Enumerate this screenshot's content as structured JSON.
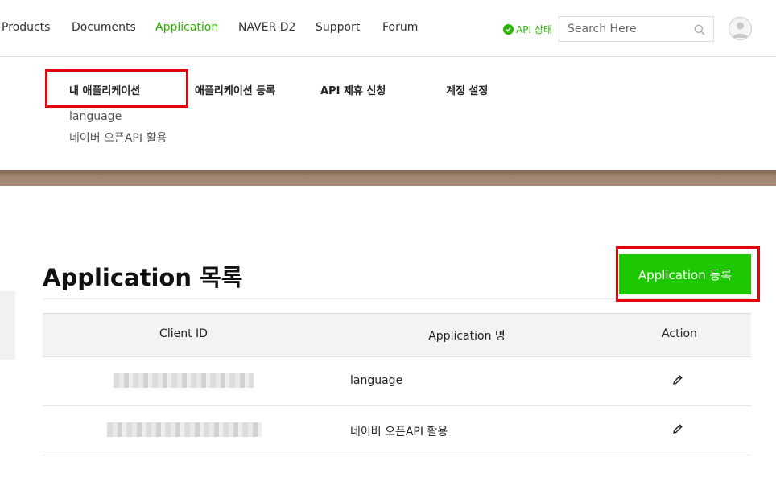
{
  "topnav": {
    "items": [
      {
        "label": "Products",
        "active": false
      },
      {
        "label": "Documents",
        "active": false
      },
      {
        "label": "Application",
        "active": true
      },
      {
        "label": "NAVER D2",
        "active": false
      },
      {
        "label": "Support",
        "active": false
      },
      {
        "label": "Forum",
        "active": false
      }
    ],
    "api_status": "API 상태",
    "search_placeholder": "Search Here"
  },
  "submenu": {
    "items": [
      {
        "label": "내 애플리케이션"
      },
      {
        "label": "애플리케이션 등록"
      },
      {
        "label": "API 제휴 신청"
      },
      {
        "label": "계정 설정"
      }
    ],
    "apps": [
      "language",
      "네이버 오픈API 활용"
    ]
  },
  "main": {
    "title": "Application 목록",
    "register_button": "Application 등록",
    "table": {
      "headers": [
        "Client ID",
        "Application 명",
        "Action"
      ],
      "rows": [
        {
          "app_name": "language"
        },
        {
          "app_name": "네이버 오픈API 활용"
        }
      ]
    }
  },
  "colors": {
    "accent": "#2db400",
    "button": "#1ec800",
    "highlight": "#e8000b",
    "band": "#a08670"
  },
  "icons": [
    "check-circle-icon",
    "search-icon",
    "user-avatar-icon",
    "pencil-icon"
  ]
}
